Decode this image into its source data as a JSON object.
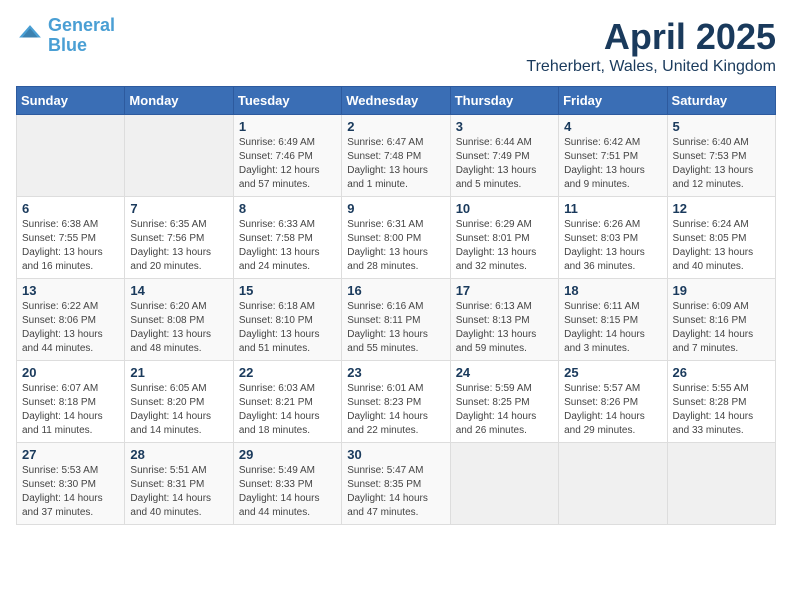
{
  "logo": {
    "text_general": "General",
    "text_blue": "Blue"
  },
  "header": {
    "title": "April 2025",
    "subtitle": "Treherbert, Wales, United Kingdom"
  },
  "weekdays": [
    "Sunday",
    "Monday",
    "Tuesday",
    "Wednesday",
    "Thursday",
    "Friday",
    "Saturday"
  ],
  "weeks": [
    [
      {
        "day": "",
        "info": ""
      },
      {
        "day": "",
        "info": ""
      },
      {
        "day": "1",
        "info": "Sunrise: 6:49 AM\nSunset: 7:46 PM\nDaylight: 12 hours and 57 minutes."
      },
      {
        "day": "2",
        "info": "Sunrise: 6:47 AM\nSunset: 7:48 PM\nDaylight: 13 hours and 1 minute."
      },
      {
        "day": "3",
        "info": "Sunrise: 6:44 AM\nSunset: 7:49 PM\nDaylight: 13 hours and 5 minutes."
      },
      {
        "day": "4",
        "info": "Sunrise: 6:42 AM\nSunset: 7:51 PM\nDaylight: 13 hours and 9 minutes."
      },
      {
        "day": "5",
        "info": "Sunrise: 6:40 AM\nSunset: 7:53 PM\nDaylight: 13 hours and 12 minutes."
      }
    ],
    [
      {
        "day": "6",
        "info": "Sunrise: 6:38 AM\nSunset: 7:55 PM\nDaylight: 13 hours and 16 minutes."
      },
      {
        "day": "7",
        "info": "Sunrise: 6:35 AM\nSunset: 7:56 PM\nDaylight: 13 hours and 20 minutes."
      },
      {
        "day": "8",
        "info": "Sunrise: 6:33 AM\nSunset: 7:58 PM\nDaylight: 13 hours and 24 minutes."
      },
      {
        "day": "9",
        "info": "Sunrise: 6:31 AM\nSunset: 8:00 PM\nDaylight: 13 hours and 28 minutes."
      },
      {
        "day": "10",
        "info": "Sunrise: 6:29 AM\nSunset: 8:01 PM\nDaylight: 13 hours and 32 minutes."
      },
      {
        "day": "11",
        "info": "Sunrise: 6:26 AM\nSunset: 8:03 PM\nDaylight: 13 hours and 36 minutes."
      },
      {
        "day": "12",
        "info": "Sunrise: 6:24 AM\nSunset: 8:05 PM\nDaylight: 13 hours and 40 minutes."
      }
    ],
    [
      {
        "day": "13",
        "info": "Sunrise: 6:22 AM\nSunset: 8:06 PM\nDaylight: 13 hours and 44 minutes."
      },
      {
        "day": "14",
        "info": "Sunrise: 6:20 AM\nSunset: 8:08 PM\nDaylight: 13 hours and 48 minutes."
      },
      {
        "day": "15",
        "info": "Sunrise: 6:18 AM\nSunset: 8:10 PM\nDaylight: 13 hours and 51 minutes."
      },
      {
        "day": "16",
        "info": "Sunrise: 6:16 AM\nSunset: 8:11 PM\nDaylight: 13 hours and 55 minutes."
      },
      {
        "day": "17",
        "info": "Sunrise: 6:13 AM\nSunset: 8:13 PM\nDaylight: 13 hours and 59 minutes."
      },
      {
        "day": "18",
        "info": "Sunrise: 6:11 AM\nSunset: 8:15 PM\nDaylight: 14 hours and 3 minutes."
      },
      {
        "day": "19",
        "info": "Sunrise: 6:09 AM\nSunset: 8:16 PM\nDaylight: 14 hours and 7 minutes."
      }
    ],
    [
      {
        "day": "20",
        "info": "Sunrise: 6:07 AM\nSunset: 8:18 PM\nDaylight: 14 hours and 11 minutes."
      },
      {
        "day": "21",
        "info": "Sunrise: 6:05 AM\nSunset: 8:20 PM\nDaylight: 14 hours and 14 minutes."
      },
      {
        "day": "22",
        "info": "Sunrise: 6:03 AM\nSunset: 8:21 PM\nDaylight: 14 hours and 18 minutes."
      },
      {
        "day": "23",
        "info": "Sunrise: 6:01 AM\nSunset: 8:23 PM\nDaylight: 14 hours and 22 minutes."
      },
      {
        "day": "24",
        "info": "Sunrise: 5:59 AM\nSunset: 8:25 PM\nDaylight: 14 hours and 26 minutes."
      },
      {
        "day": "25",
        "info": "Sunrise: 5:57 AM\nSunset: 8:26 PM\nDaylight: 14 hours and 29 minutes."
      },
      {
        "day": "26",
        "info": "Sunrise: 5:55 AM\nSunset: 8:28 PM\nDaylight: 14 hours and 33 minutes."
      }
    ],
    [
      {
        "day": "27",
        "info": "Sunrise: 5:53 AM\nSunset: 8:30 PM\nDaylight: 14 hours and 37 minutes."
      },
      {
        "day": "28",
        "info": "Sunrise: 5:51 AM\nSunset: 8:31 PM\nDaylight: 14 hours and 40 minutes."
      },
      {
        "day": "29",
        "info": "Sunrise: 5:49 AM\nSunset: 8:33 PM\nDaylight: 14 hours and 44 minutes."
      },
      {
        "day": "30",
        "info": "Sunrise: 5:47 AM\nSunset: 8:35 PM\nDaylight: 14 hours and 47 minutes."
      },
      {
        "day": "",
        "info": ""
      },
      {
        "day": "",
        "info": ""
      },
      {
        "day": "",
        "info": ""
      }
    ]
  ]
}
